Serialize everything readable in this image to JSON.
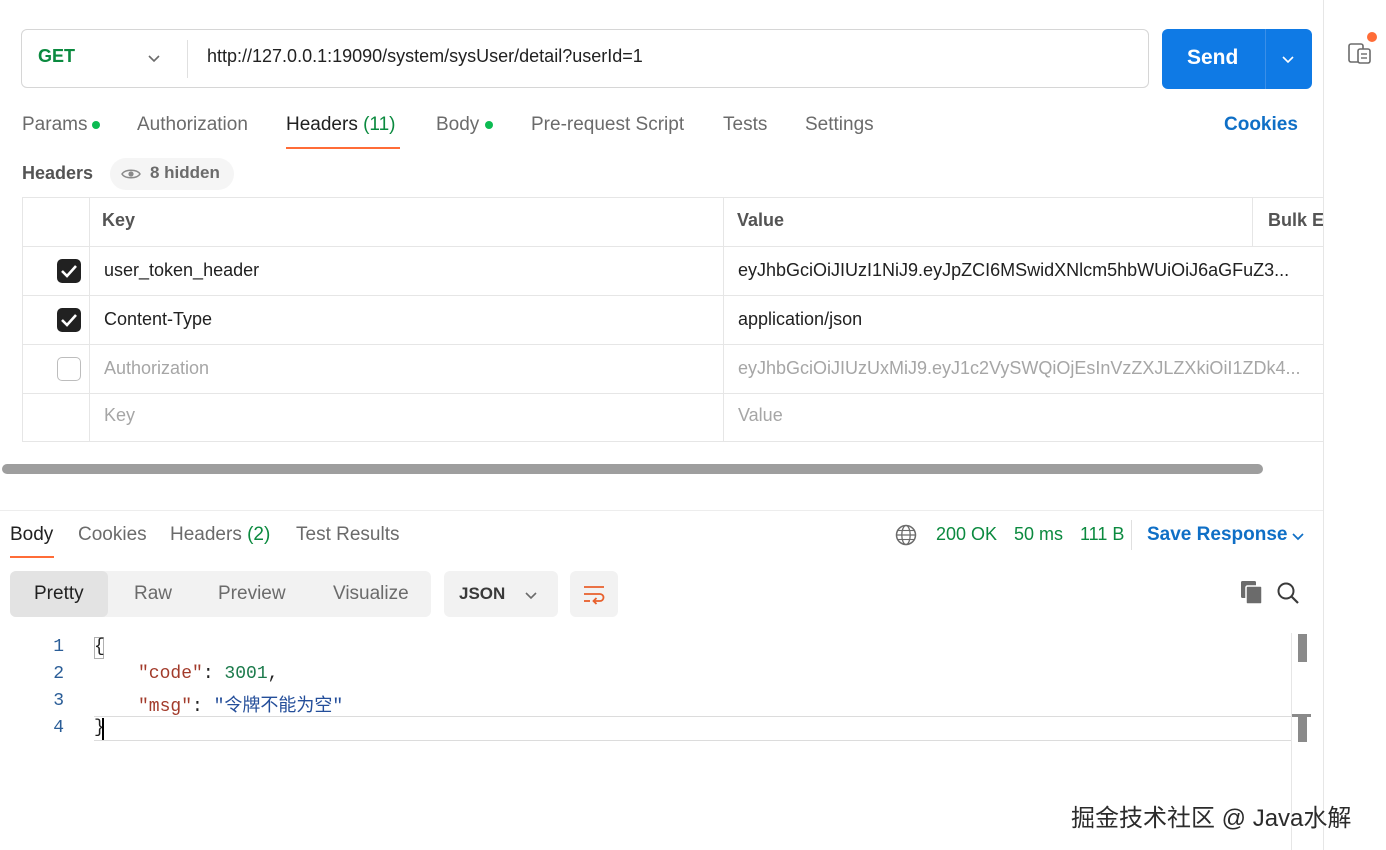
{
  "request": {
    "method": "GET",
    "url": "http://127.0.0.1:19090/system/sysUser/detail?userId=1",
    "send_label": "Send"
  },
  "request_tabs": {
    "params": "Params",
    "authorization": "Authorization",
    "headers": "Headers",
    "headers_count": "(11)",
    "body": "Body",
    "pre_request": "Pre-request Script",
    "tests": "Tests",
    "settings": "Settings",
    "cookies": "Cookies"
  },
  "headers_section": {
    "title": "Headers",
    "hidden_label": "8 hidden"
  },
  "headers_table": {
    "columns": {
      "key": "Key",
      "value": "Value",
      "bulk_edit": "Bulk Ed"
    },
    "rows": [
      {
        "checked": true,
        "key": "user_token_header",
        "value": "eyJhbGciOiJIUzI1NiJ9.eyJpZCI6MSwidXNlcm5hbWUiOiJ6aGFuZ3..."
      },
      {
        "checked": true,
        "key": "Content-Type",
        "value": "application/json"
      },
      {
        "checked": false,
        "key": "Authorization",
        "value": "eyJhbGciOiJIUzUxMiJ9.eyJ1c2VySWQiOjEsInVzZXJLZXkiOiI1ZDk4..."
      }
    ],
    "new_row": {
      "key_placeholder": "Key",
      "value_placeholder": "Value"
    }
  },
  "response_tabs": {
    "body": "Body",
    "cookies": "Cookies",
    "headers": "Headers",
    "headers_count": "(2)",
    "test_results": "Test Results"
  },
  "response_status": {
    "status": "200 OK",
    "time": "50 ms",
    "size": "111 B",
    "save_response": "Save Response"
  },
  "view_modes": {
    "pretty": "Pretty",
    "raw": "Raw",
    "preview": "Preview",
    "visualize": "Visualize",
    "format": "JSON"
  },
  "code": {
    "line_numbers": [
      "1",
      "2",
      "3",
      "4"
    ],
    "open_brace": "{",
    "close_brace": "}",
    "line2_key": "\"code\"",
    "line2_colon": ": ",
    "line2_value": "3001",
    "line2_comma": ",",
    "line3_key": "\"msg\"",
    "line3_colon": ": ",
    "line3_value": "\"令牌不能为空\""
  },
  "watermark": "掘金技术社区 @ Java水解",
  "colors": {
    "accent_orange": "#ff6c37",
    "send_blue": "#0f7ae5",
    "status_green": "#0b8a3f",
    "link_blue": "#0f6fc6"
  }
}
